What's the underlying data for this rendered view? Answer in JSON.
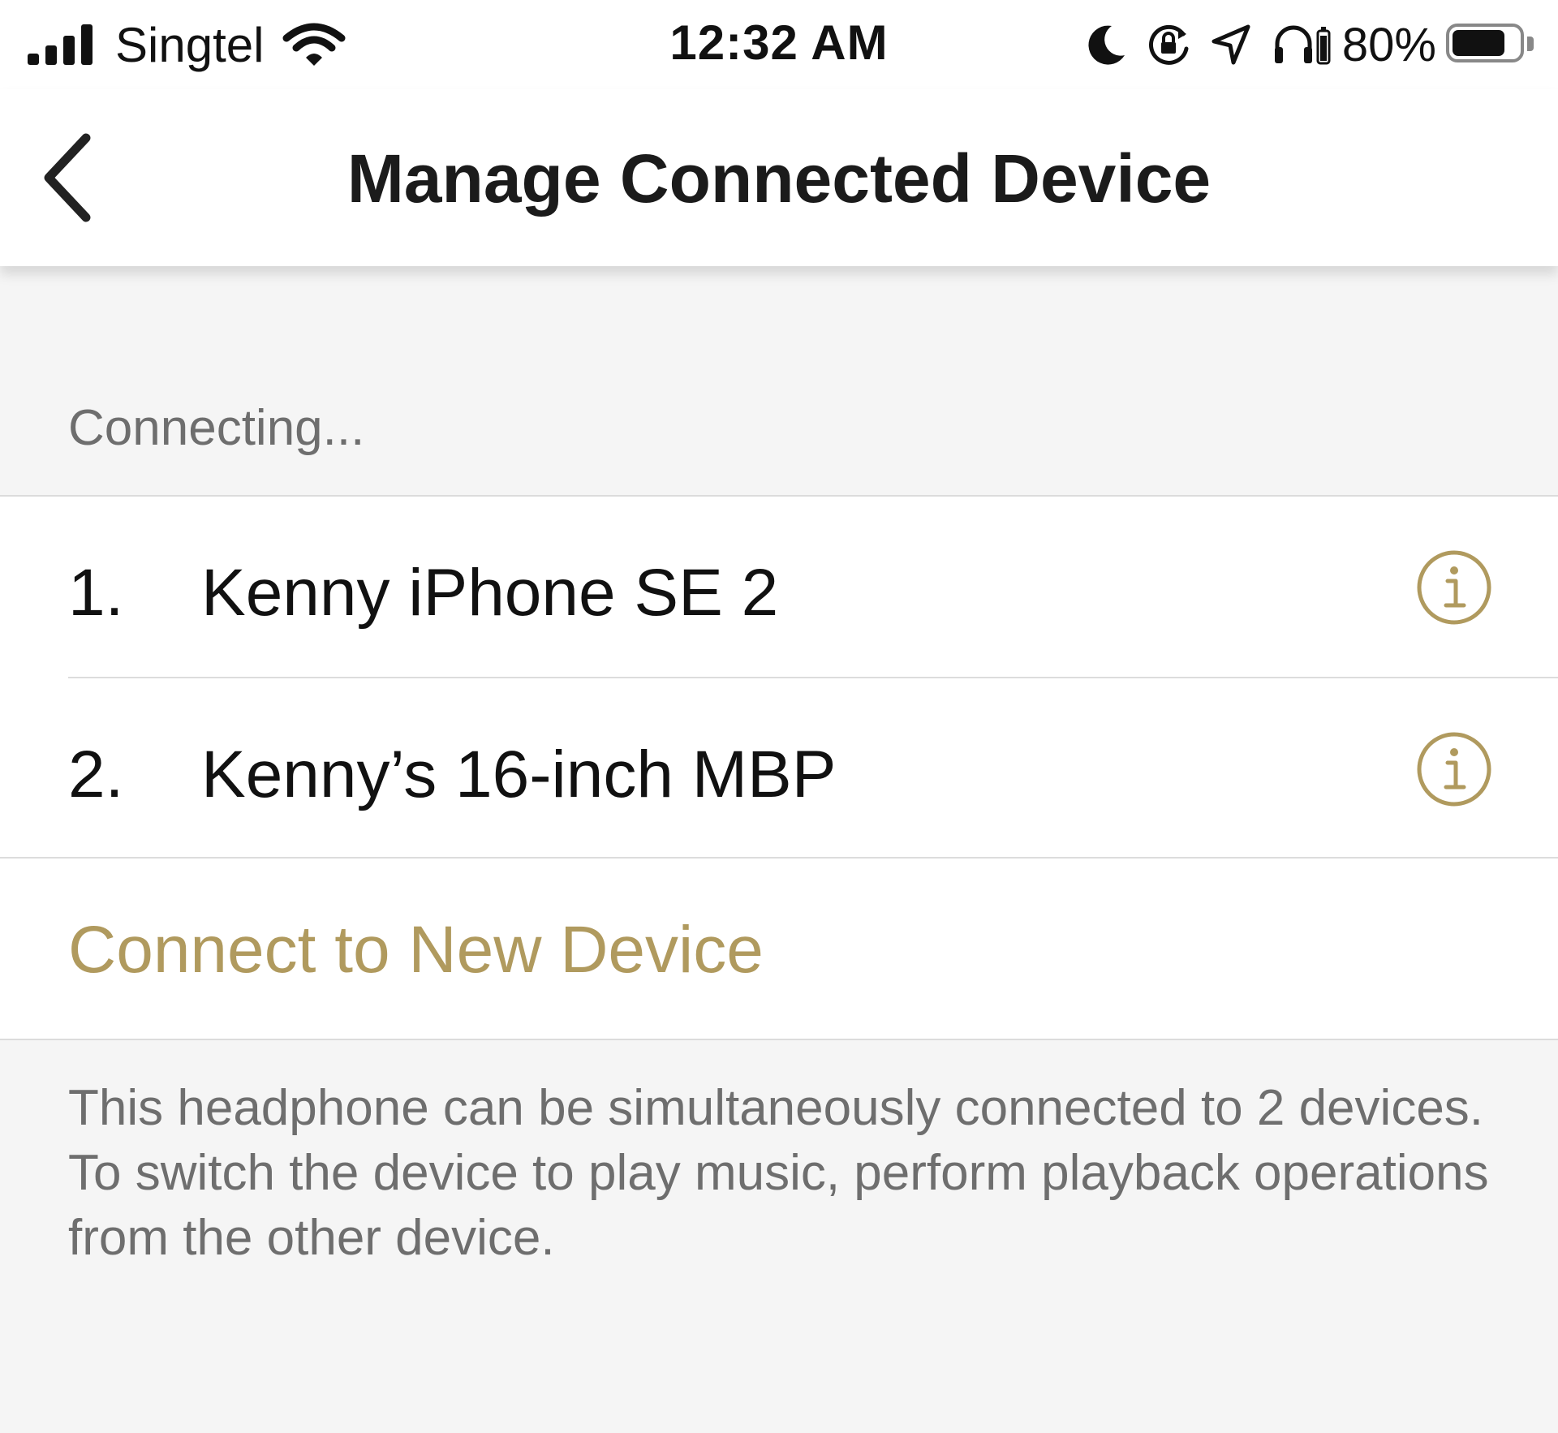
{
  "status_bar": {
    "carrier": "Singtel",
    "time": "12:32 AM",
    "battery_percent": "80%",
    "battery_level": 0.8,
    "icons": [
      "signal-icon",
      "wifi-icon",
      "moon-icon",
      "rotation-lock-icon",
      "location-arrow-icon",
      "headphones-battery-icon",
      "battery-icon"
    ]
  },
  "nav": {
    "back_icon": "chevron-left-icon",
    "title": "Manage Connected Device"
  },
  "section": {
    "header": "Connecting..."
  },
  "devices": [
    {
      "index": "1.",
      "name": "Kenny iPhone SE 2",
      "icon": "info-icon"
    },
    {
      "index": "2.",
      "name": "Kenny’s 16-inch MBP",
      "icon": "info-icon"
    }
  ],
  "connect_new": {
    "label": "Connect to New Device"
  },
  "footnote": {
    "line1": "This headphone can be simultaneously connected to 2 devices.",
    "line2": "To switch the device to play music, perform playback operations from the other device."
  },
  "colors": {
    "accent": "#b09a5e",
    "background": "#f5f5f5",
    "secondary_text": "#6e6e6e"
  }
}
